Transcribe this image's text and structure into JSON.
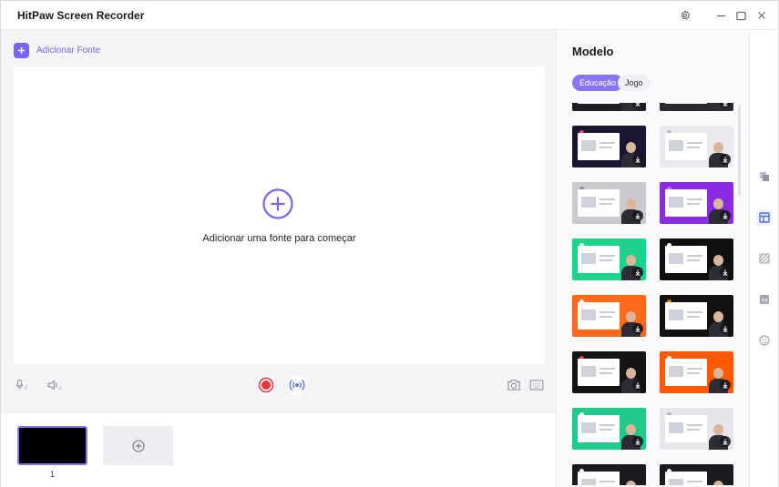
{
  "app": {
    "title": "HitPaw Screen Recorder"
  },
  "titlebar": {
    "icons": [
      "gear-icon",
      "minimize-icon",
      "maximize-icon",
      "close-icon"
    ]
  },
  "main": {
    "add_source_label": "Adicionar Fonte",
    "empty_message": "Adicionar uma fonte para começar",
    "controls": {
      "left": [
        "microphone-icon",
        "speaker-icon"
      ],
      "center": [
        "record-icon",
        "live-stream-icon"
      ],
      "right": [
        "camera-icon",
        "keyboard-icon"
      ]
    }
  },
  "scenes": {
    "items": [
      {
        "number": "1"
      }
    ],
    "add_icon": "plus-circle-icon"
  },
  "templates_panel": {
    "title": "Modelo",
    "tabs": [
      {
        "label": "Educação",
        "active": true
      },
      {
        "label": "Jogo",
        "active": false
      }
    ],
    "thumbnails": [
      {
        "bg": "#1e1e22",
        "accent": "#7b63f2"
      },
      {
        "bg": "#2a2a30",
        "accent": "#a657ff"
      },
      {
        "bg": "#1a1530",
        "accent": "#ff3d7f"
      },
      {
        "bg": "#e9e9ee",
        "accent": "#b8b8c2"
      },
      {
        "bg": "#c9c9d0",
        "accent": "#8f8f99"
      },
      {
        "bg": "#8a2be2",
        "accent": "#c46bff"
      },
      {
        "bg": "#1fd18b",
        "accent": "#e6fff3"
      },
      {
        "bg": "#0f0f12",
        "accent": "#ffffff"
      },
      {
        "bg": "#ff6a1a",
        "accent": "#ffffff"
      },
      {
        "bg": "#111111",
        "accent": "#ff7a00"
      },
      {
        "bg": "#141416",
        "accent": "#ff3b3b"
      },
      {
        "bg": "#ff5a00",
        "accent": "#ffffff"
      },
      {
        "bg": "#22c98a",
        "accent": "#ffffff"
      },
      {
        "bg": "#e6e6ea",
        "accent": "#b0b0b8"
      },
      {
        "bg": "#1a1a1e",
        "accent": "#ffffff"
      },
      {
        "bg": "#1a1a1e",
        "accent": "#ffffff"
      }
    ]
  },
  "right_rail": {
    "items": [
      {
        "icon": "layers-icon",
        "active": false
      },
      {
        "icon": "template-layout-icon",
        "active": true
      },
      {
        "icon": "pattern-icon",
        "active": false
      },
      {
        "icon": "text-icon",
        "active": false
      },
      {
        "icon": "sticker-icon",
        "active": false
      }
    ]
  }
}
